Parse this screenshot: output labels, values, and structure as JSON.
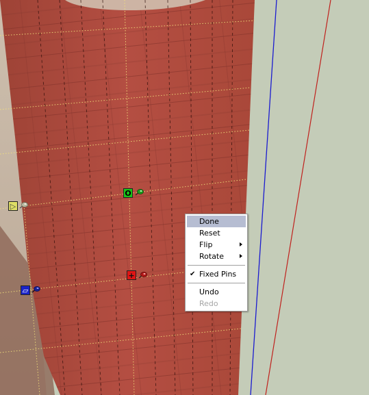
{
  "context_menu": {
    "items": [
      {
        "label": "Done",
        "state": "highlighted"
      },
      {
        "label": "Reset"
      },
      {
        "label": "Flip",
        "submenu": true
      },
      {
        "label": "Rotate",
        "submenu": true
      },
      {
        "separator": true
      },
      {
        "label": "Fixed Pins",
        "checked": true
      },
      {
        "separator": true
      },
      {
        "label": "Undo"
      },
      {
        "label": "Redo",
        "state": "disabled"
      }
    ],
    "check_glyph": "✔",
    "highlight_color": "#b6bdd2"
  },
  "pins": {
    "scale": {
      "glyph": "O",
      "color": "#19c419",
      "pin_color": "#1b9a1b",
      "icon": "scale-pin-icon"
    },
    "shear": {
      "glyph": "▷",
      "color": "#dede66",
      "pin_color": "#b8b8a0",
      "icon": "shear-pin-icon"
    },
    "distort": {
      "glyph": "▱",
      "color": "#1a23c8",
      "pin_color": "#1a2090",
      "icon": "distort-pin-icon"
    },
    "move": {
      "glyph": "+",
      "color": "#e01414",
      "pin_color": "#b01818",
      "icon": "move-pin-icon"
    }
  },
  "colors": {
    "texture_main": "#b04b40",
    "texture_dark": "#8e3a31",
    "background": "#c4ccb8",
    "blue_axis": "#1a1ad0",
    "red_axis": "#c0201c"
  }
}
